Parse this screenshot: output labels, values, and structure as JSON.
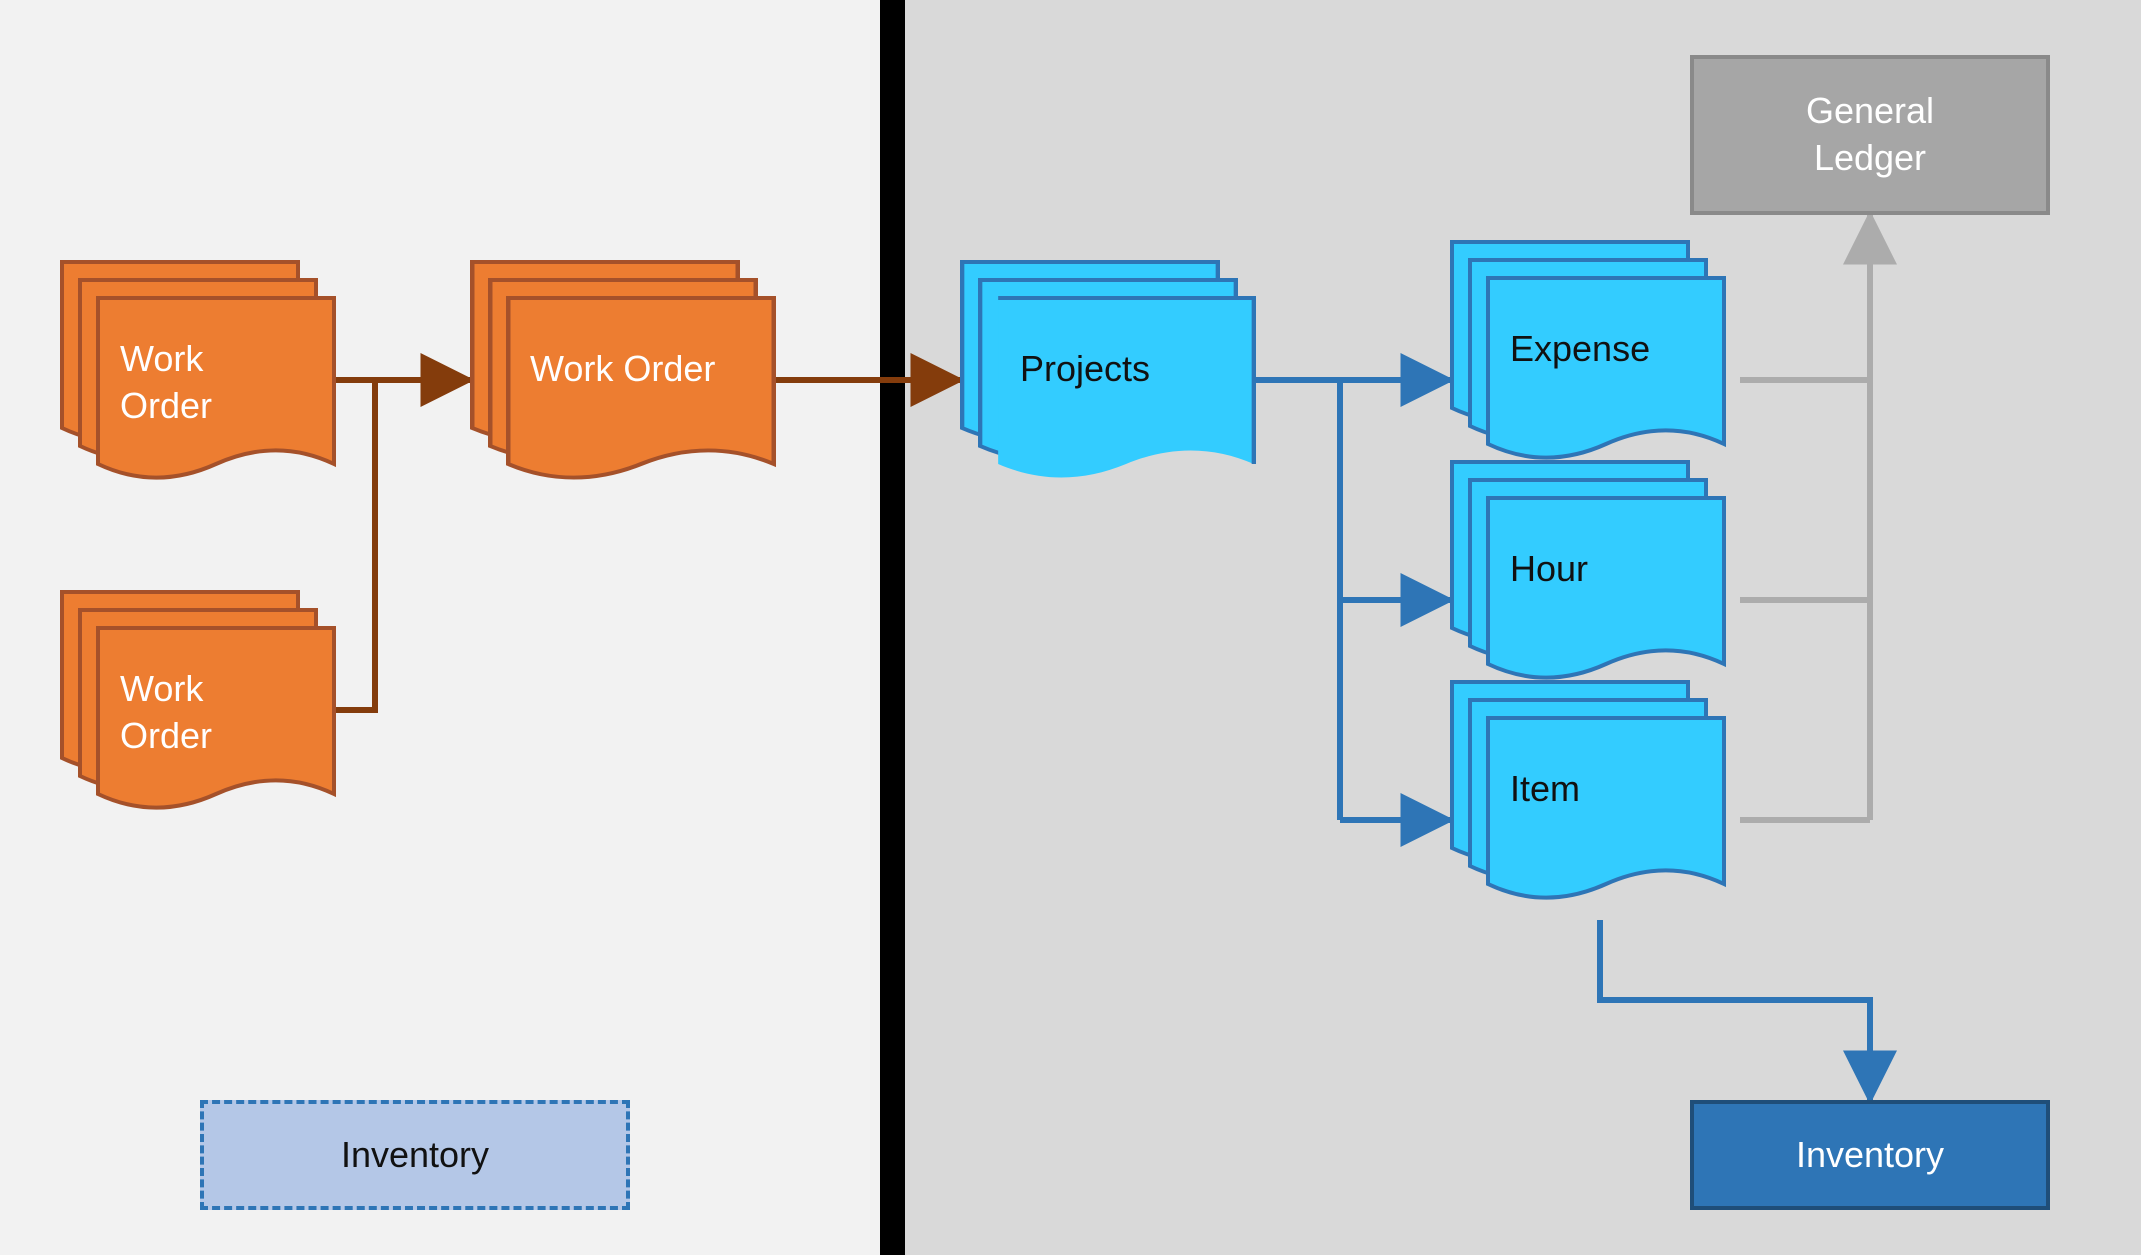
{
  "panels": {
    "left_bg": "#f2f2f2",
    "right_bg": "#d9d9d9",
    "divider_color": "#000000"
  },
  "nodes": {
    "work_order_top": {
      "label": "Work\nOrder"
    },
    "work_order_bottom": {
      "label": "Work\nOrder"
    },
    "work_order_main": {
      "label": "Work Order"
    },
    "projects": {
      "label": "Projects"
    },
    "expense": {
      "label": "Expense"
    },
    "hour": {
      "label": "Hour"
    },
    "item": {
      "label": "Item"
    },
    "general_ledger": {
      "label": "General\nLedger"
    },
    "inventory_left": {
      "label": "Inventory"
    },
    "inventory_right": {
      "label": "Inventory"
    }
  },
  "colors": {
    "orange_fill": "#ED7D31",
    "orange_stroke": "#A5512A",
    "cyan_fill": "#33CCFF",
    "cyan_stroke": "#2E75B6",
    "blue_arrow": "#2E75B6",
    "gray_arrow": "#ACACAC",
    "brown_arrow": "#843C0C",
    "gl_fill": "#A6A6A6",
    "inv_dashed_fill": "#B4C7E7",
    "inv_solid_fill": "#2E75B6"
  },
  "edges": [
    {
      "from": "work_order_top",
      "to": "work_order_main",
      "color": "brown",
      "arrow": true
    },
    {
      "from": "work_order_bottom",
      "to": "work_order_main",
      "color": "brown",
      "arrow": false
    },
    {
      "from": "work_order_main",
      "to": "projects",
      "color": "brown",
      "arrow": true
    },
    {
      "from": "projects",
      "to": "expense",
      "color": "blue",
      "arrow": true
    },
    {
      "from": "projects",
      "to": "hour",
      "color": "blue",
      "arrow": true
    },
    {
      "from": "projects",
      "to": "item",
      "color": "blue",
      "arrow": true
    },
    {
      "from": "expense",
      "to": "general_ledger",
      "color": "gray",
      "arrow": false
    },
    {
      "from": "hour",
      "to": "general_ledger",
      "color": "gray",
      "arrow": false
    },
    {
      "from": "item",
      "to": "general_ledger",
      "color": "gray",
      "arrow": true
    },
    {
      "from": "item",
      "to": "inventory_right",
      "color": "blue",
      "arrow": true
    }
  ]
}
